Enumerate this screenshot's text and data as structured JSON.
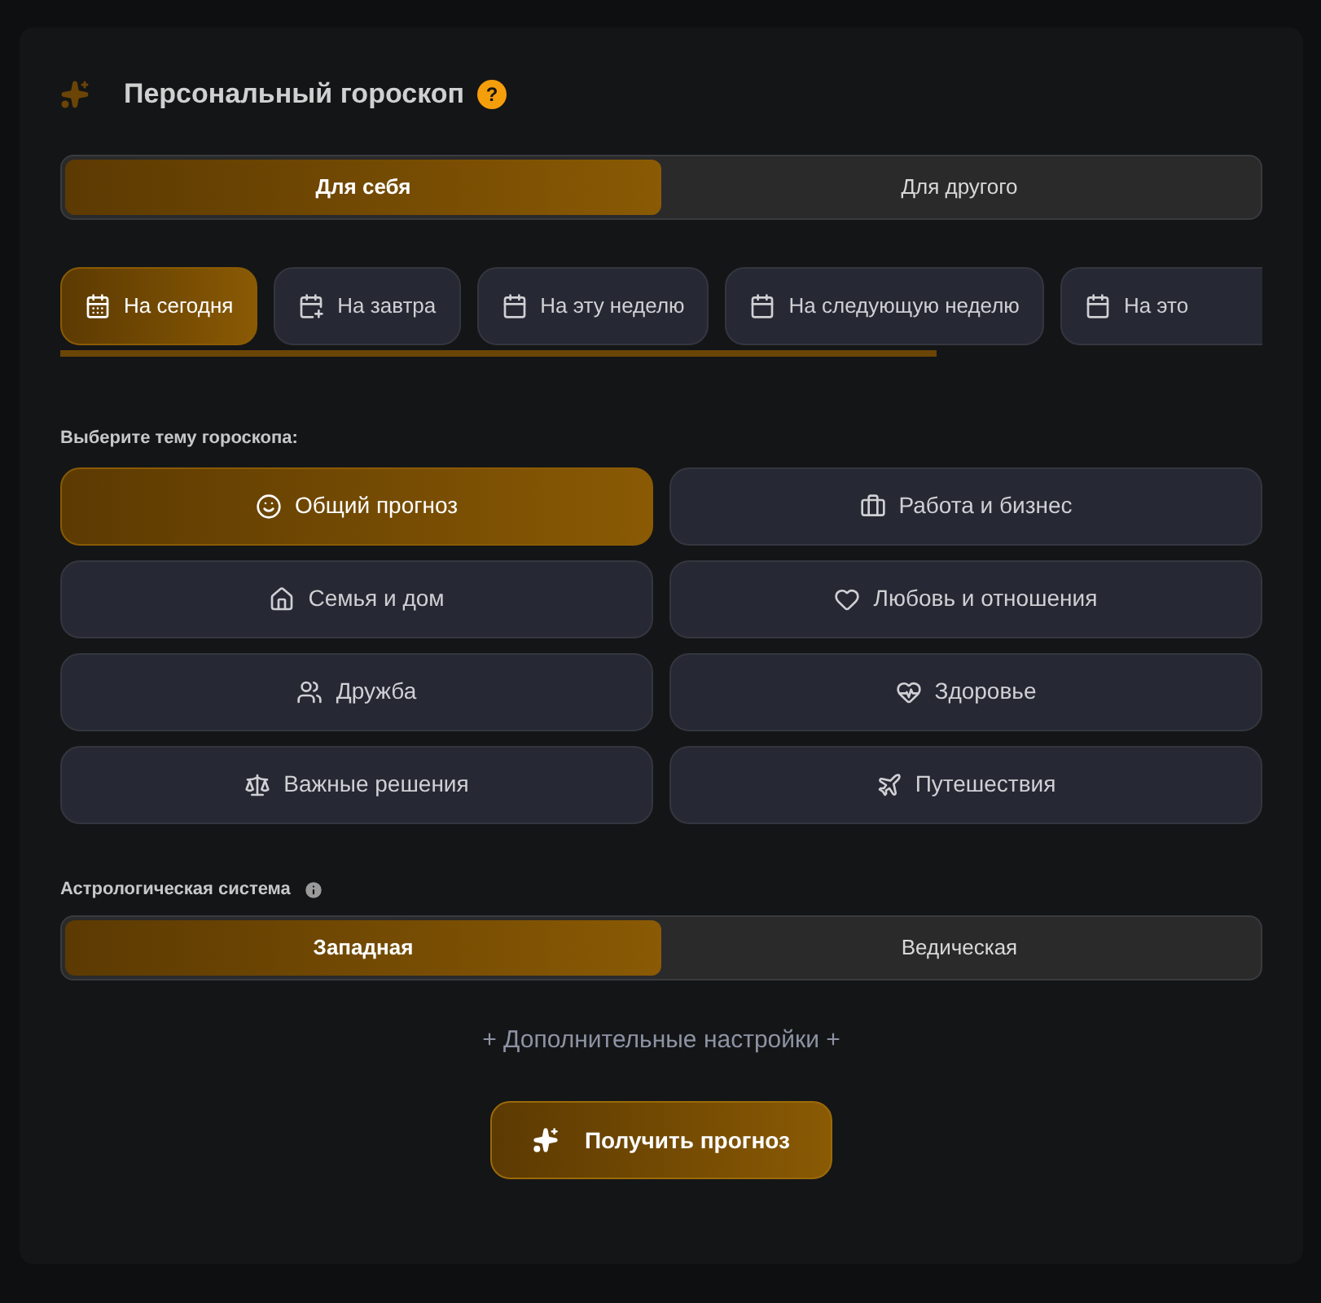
{
  "header": {
    "title": "Персональный гороскоп",
    "help": "?"
  },
  "target_tabs": [
    {
      "label": "Для себя",
      "selected": true
    },
    {
      "label": "Для другого",
      "selected": false
    }
  ],
  "period_tabs": [
    {
      "label": "На сегодня",
      "selected": true
    },
    {
      "label": "На завтра",
      "selected": false
    },
    {
      "label": "На эту неделю",
      "selected": false
    },
    {
      "label": "На следующую неделю",
      "selected": false
    },
    {
      "label": "На это",
      "selected": false
    }
  ],
  "topic_label": "Выберите тему гороскопа:",
  "topics": [
    {
      "label": "Общий прогноз",
      "selected": true
    },
    {
      "label": "Работа и бизнес",
      "selected": false
    },
    {
      "label": "Семья и дом",
      "selected": false
    },
    {
      "label": "Любовь и отношения",
      "selected": false
    },
    {
      "label": "Дружба",
      "selected": false
    },
    {
      "label": "Здоровье",
      "selected": false
    },
    {
      "label": "Важные решения",
      "selected": false
    },
    {
      "label": "Путешествия",
      "selected": false
    }
  ],
  "system_label": "Астрологическая система",
  "system_tabs": [
    {
      "label": "Западная",
      "selected": true
    },
    {
      "label": "Ведическая",
      "selected": false
    }
  ],
  "more_settings": "+ Дополнительные настройки +",
  "submit": "Получить прогноз"
}
